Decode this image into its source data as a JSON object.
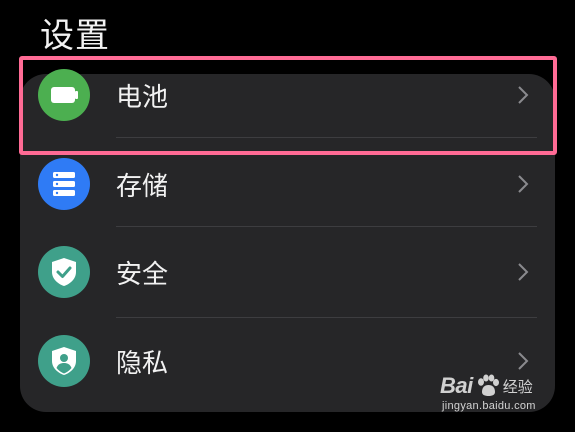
{
  "header": {
    "title": "设置"
  },
  "settings": {
    "items": [
      {
        "label": "电池",
        "icon": "battery-icon",
        "icon_color": "#4caf50"
      },
      {
        "label": "存储",
        "icon": "storage-icon",
        "icon_color": "#2f7bf5"
      },
      {
        "label": "安全",
        "icon": "shield-check-icon",
        "icon_color": "#3fa08a"
      },
      {
        "label": "隐私",
        "icon": "privacy-shield-icon",
        "icon_color": "#3fa08a"
      }
    ]
  },
  "highlight": {
    "color": "#ff6b95",
    "target": "电池"
  },
  "watermark": {
    "brand_prefix": "Bai",
    "brand_suffix": "经验",
    "url": "jingyan.baidu.com"
  },
  "colors": {
    "background": "#000000",
    "card": "#262628",
    "text": "#f2f2f2",
    "chevron": "#8a8a8e"
  }
}
